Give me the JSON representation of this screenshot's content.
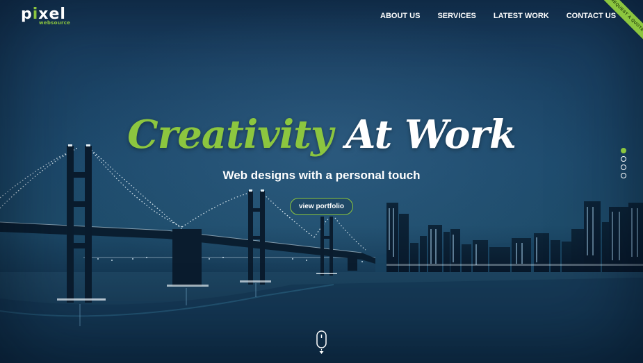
{
  "brand": {
    "name_prefix": "p",
    "name_dot": "i",
    "name_suffix": "xel",
    "tagline": "websource"
  },
  "nav": {
    "items": [
      "ABOUT US",
      "SERVICES",
      "LATEST WORK",
      "CONTACT US"
    ]
  },
  "ribbon": {
    "label": "REQUEST A QUOTE"
  },
  "hero": {
    "headline_accent": "Creativity",
    "headline_rest": "At Work",
    "subheading": "Web designs with a personal touch",
    "cta_label": "view portfolio"
  },
  "slider": {
    "count": 4,
    "active_index": 0
  },
  "colors": {
    "accent": "#8cc63f",
    "overlay": "#1d4a6c",
    "text": "#ffffff"
  },
  "icons": [
    "mouse-scroll-icon"
  ]
}
